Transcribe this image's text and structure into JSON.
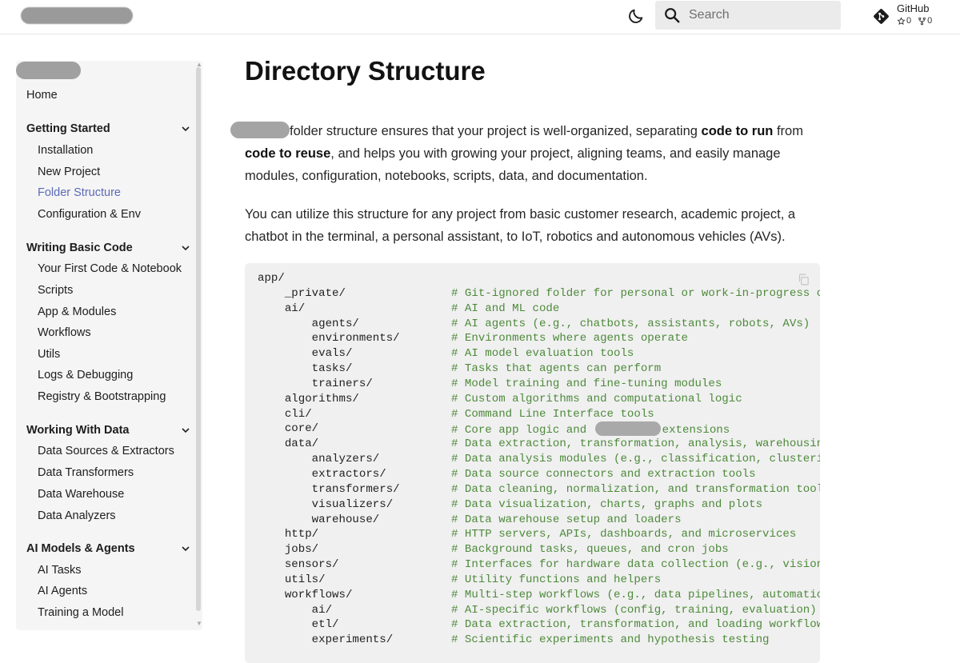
{
  "header": {
    "search_placeholder": "Search",
    "github": {
      "label": "GitHub",
      "stars": "0",
      "forks": "0"
    }
  },
  "sidebar": {
    "home": "Home",
    "sections": [
      {
        "title": "Getting Started",
        "items": [
          "Installation",
          "New Project",
          "Folder Structure",
          "Configuration & Env"
        ]
      },
      {
        "title": "Writing Basic Code",
        "items": [
          "Your First Code & Notebook",
          "Scripts",
          "App & Modules",
          "Workflows",
          "Utils",
          "Logs & Debugging",
          "Registry & Bootstrapping"
        ]
      },
      {
        "title": "Working With Data",
        "items": [
          "Data Sources & Extractors",
          "Data Transformers",
          "Data Warehouse",
          "Data Analyzers"
        ]
      },
      {
        "title": "AI Models & Agents",
        "items": [
          "AI Tasks",
          "AI Agents",
          "Training a Model"
        ]
      }
    ],
    "active_item": "Folder Structure"
  },
  "main": {
    "title": "Directory Structure",
    "p1": {
      "t1": "folder structure ensures that your project is well-organized, separating ",
      "b1": "code to run",
      "t2": " from ",
      "b2": "code to reuse",
      "t3": ", and helps you with growing your project, aligning teams, and easily manage modules, configuration, notebooks, scripts, data, and documentation."
    },
    "p2": "You can utilize this structure for any project from basic customer research, academic project, a chatbot in the terminal, a personal assistant, to IoT, robotics and autonomous vehicles (AVs).",
    "code_lines": [
      {
        "path": "app/",
        "comment": ""
      },
      {
        "path": "    _private/",
        "comment": "# Git-ignored folder for personal or work-in-progress code"
      },
      {
        "path": "    ai/",
        "comment": "# AI and ML code"
      },
      {
        "path": "        agents/",
        "comment": "# AI agents (e.g., chatbots, assistants, robots, AVs)"
      },
      {
        "path": "        environments/",
        "comment": "# Environments where agents operate"
      },
      {
        "path": "        evals/",
        "comment": "# AI model evaluation tools"
      },
      {
        "path": "        tasks/",
        "comment": "# Tasks that agents can perform"
      },
      {
        "path": "        trainers/",
        "comment": "# Model training and fine-tuning modules"
      },
      {
        "path": "    algorithms/",
        "comment": "# Custom algorithms and computational logic"
      },
      {
        "path": "    cli/",
        "comment": "# Command Line Interface tools"
      },
      {
        "path": "    core/",
        "comment": "# Core app logic and",
        "comment_after": "extensions"
      },
      {
        "path": "    data/",
        "comment": "# Data extraction, transformation, analysis, warehousing"
      },
      {
        "path": "        analyzers/",
        "comment": "# Data analysis modules (e.g., classification, clustering)"
      },
      {
        "path": "        extractors/",
        "comment": "# Data source connectors and extraction tools"
      },
      {
        "path": "        transformers/",
        "comment": "# Data cleaning, normalization, and transformation tools"
      },
      {
        "path": "        visualizers/",
        "comment": "# Data visualization, charts, graphs and plots"
      },
      {
        "path": "        warehouse/",
        "comment": "# Data warehouse setup and loaders"
      },
      {
        "path": "    http/",
        "comment": "# HTTP servers, APIs, dashboards, and microservices"
      },
      {
        "path": "    jobs/",
        "comment": "# Background tasks, queues, and cron jobs"
      },
      {
        "path": "    sensors/",
        "comment": "# Interfaces for hardware data collection (e.g., vision)"
      },
      {
        "path": "    utils/",
        "comment": "# Utility functions and helpers"
      },
      {
        "path": "    workflows/",
        "comment": "# Multi-step workflows (e.g., data pipelines, automation)"
      },
      {
        "path": "        ai/",
        "comment": "# AI-specific workflows (config, training, evaluation)"
      },
      {
        "path": "        etl/",
        "comment": "# Data extraction, transformation, and loading workflows"
      },
      {
        "path": "        experiments/",
        "comment": "# Scientific experiments and hypothesis testing"
      }
    ]
  },
  "icons": {
    "theme": "moon-icon",
    "search": "search-icon",
    "github": "git-icon",
    "star": "star-icon",
    "fork": "fork-icon",
    "copy": "copy-icon",
    "chevron": "chevron-down-icon"
  },
  "colors": {
    "accent": "#5a6ab8",
    "code_comment": "#4e8a3b",
    "code_bg": "#f0f0f0",
    "sidebar_bg": "#f5f5f5",
    "search_bg": "#ebebeb"
  }
}
